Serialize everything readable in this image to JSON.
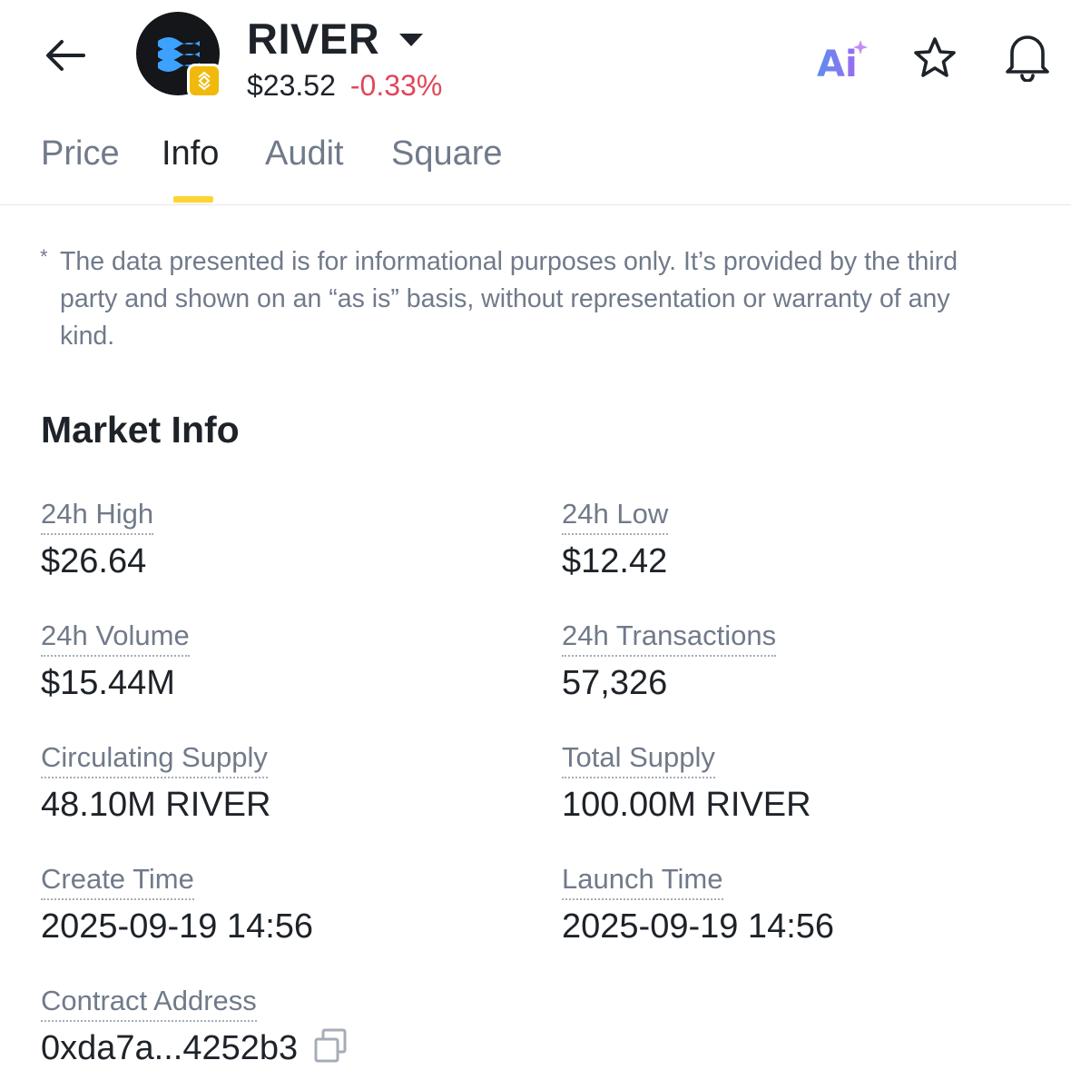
{
  "header": {
    "token_name": "RIVER",
    "price": "$23.52",
    "change": "-0.33%",
    "change_color": "#e0475a",
    "ai_label": "Ai",
    "icons": [
      "back-arrow-icon",
      "river-logo-icon",
      "bnb-chain-icon",
      "caret-down-icon",
      "ai-icon",
      "star-icon",
      "bell-icon"
    ]
  },
  "tabs": [
    {
      "label": "Price",
      "active": false
    },
    {
      "label": "Info",
      "active": true
    },
    {
      "label": "Audit",
      "active": false
    },
    {
      "label": "Square",
      "active": false
    }
  ],
  "accent_color": "#fcd535",
  "disclaimer": {
    "asterisk": "*",
    "text": "The data presented is for informational purposes only. It’s provided by the third party and shown on an “as is” basis, without representation or warranty of any kind."
  },
  "market_info": {
    "title": "Market Info",
    "fields": [
      {
        "label": "24h High",
        "value": "$26.64"
      },
      {
        "label": "24h Low",
        "value": "$12.42"
      },
      {
        "label": "24h Volume",
        "value": "$15.44M"
      },
      {
        "label": "24h Transactions",
        "value": "57,326"
      },
      {
        "label": "Circulating Supply",
        "value": "48.10M RIVER"
      },
      {
        "label": "Total Supply",
        "value": "100.00M RIVER"
      },
      {
        "label": "Create Time",
        "value": "2025-09-19 14:56"
      },
      {
        "label": "Launch Time",
        "value": "2025-09-19 14:56"
      },
      {
        "label": "Contract Address",
        "value": "0xda7a...4252b3"
      }
    ]
  }
}
